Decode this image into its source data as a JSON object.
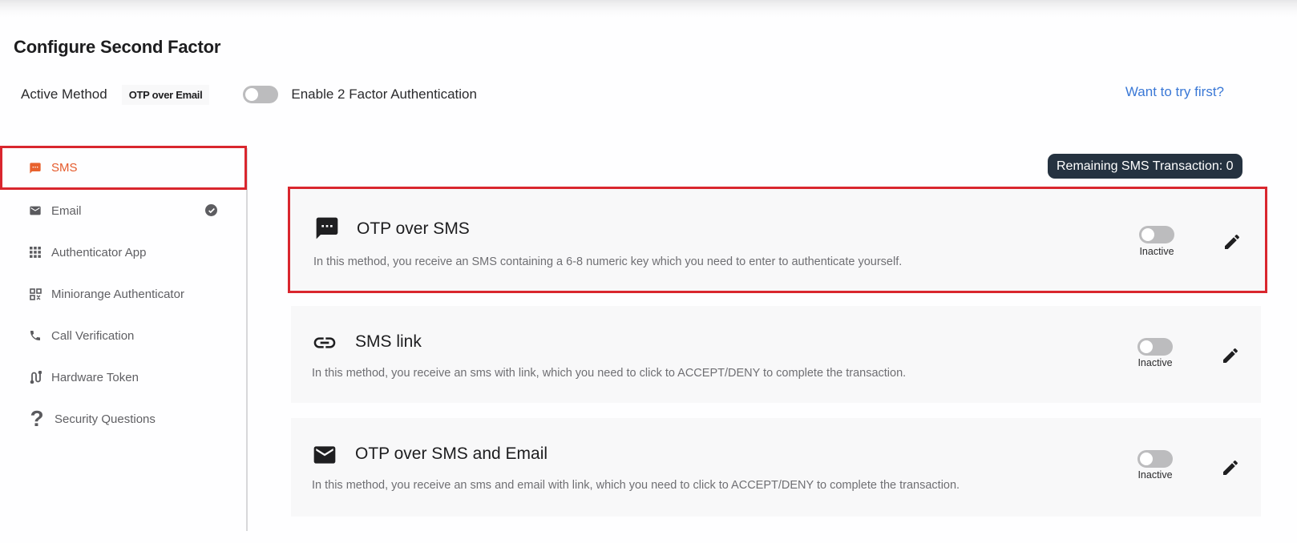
{
  "page": {
    "title": "Configure Second Factor"
  },
  "header": {
    "active_method_label": "Active Method",
    "active_method_value": "OTP over Email",
    "enable_2fa_label": "Enable 2 Factor Authentication",
    "enable_2fa_state": "off",
    "try_first_link": "Want to try first?"
  },
  "sidebar": {
    "items": [
      {
        "label": "SMS",
        "icon": "sms-icon",
        "active": true,
        "configured": false
      },
      {
        "label": "Email",
        "icon": "email-icon",
        "active": false,
        "configured": true
      },
      {
        "label": "Authenticator App",
        "icon": "apps-grid-icon",
        "active": false,
        "configured": false
      },
      {
        "label": "Miniorange Authenticator",
        "icon": "qr-code-icon",
        "active": false,
        "configured": false
      },
      {
        "label": "Call Verification",
        "icon": "phone-icon",
        "active": false,
        "configured": false
      },
      {
        "label": "Hardware Token",
        "icon": "hardware-token-icon",
        "active": false,
        "configured": false
      },
      {
        "label": "Security Questions",
        "icon": "question-mark-icon",
        "active": false,
        "configured": false
      }
    ]
  },
  "main": {
    "remaining_sms_badge": "Remaining SMS Transaction: 0",
    "methods": [
      {
        "title": "OTP over SMS",
        "icon": "sms-icon",
        "description": "In this method, you receive an SMS containing a 6-8 numeric key which you need to enter to authenticate yourself.",
        "status": "Inactive",
        "selected": true
      },
      {
        "title": "SMS link",
        "icon": "link-icon",
        "description": "In this method, you receive an sms with link, which you need to click to ACCEPT/DENY to complete the transaction.",
        "status": "Inactive",
        "selected": false
      },
      {
        "title": "OTP over SMS and Email",
        "icon": "email-icon",
        "description": "In this method, you receive an sms and email with link, which you need to click to ACCEPT/DENY to complete the transaction.",
        "status": "Inactive",
        "selected": false
      }
    ]
  },
  "colors": {
    "accent_orange": "#e55a2b",
    "highlight_red": "#d9262e",
    "link_blue": "#3a78d6",
    "badge_dark": "#253240"
  }
}
